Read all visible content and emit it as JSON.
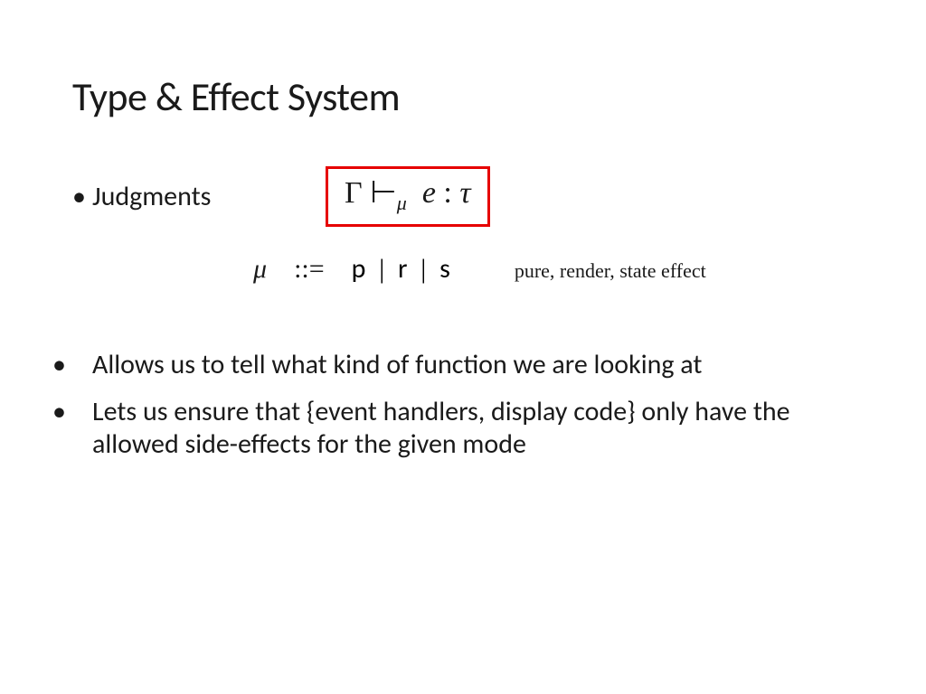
{
  "title": "Type & Effect System",
  "bullets": {
    "judgments": "Judgments",
    "b2": "Allows us to tell what kind of function we are looking at",
    "b3": "Lets us ensure that {event handlers, display code} only have the allowed side-effects for the given mode"
  },
  "formula": {
    "gamma": "Γ",
    "turnstile": "⊢",
    "mu": "μ",
    "expr": "e",
    "colon": ":",
    "tau": "τ"
  },
  "grammar": {
    "lhs": "μ",
    "bnf": "::=",
    "p": "p",
    "r": "r",
    "s": "s",
    "sep": "|",
    "annotation": "pure, render, state effect"
  }
}
